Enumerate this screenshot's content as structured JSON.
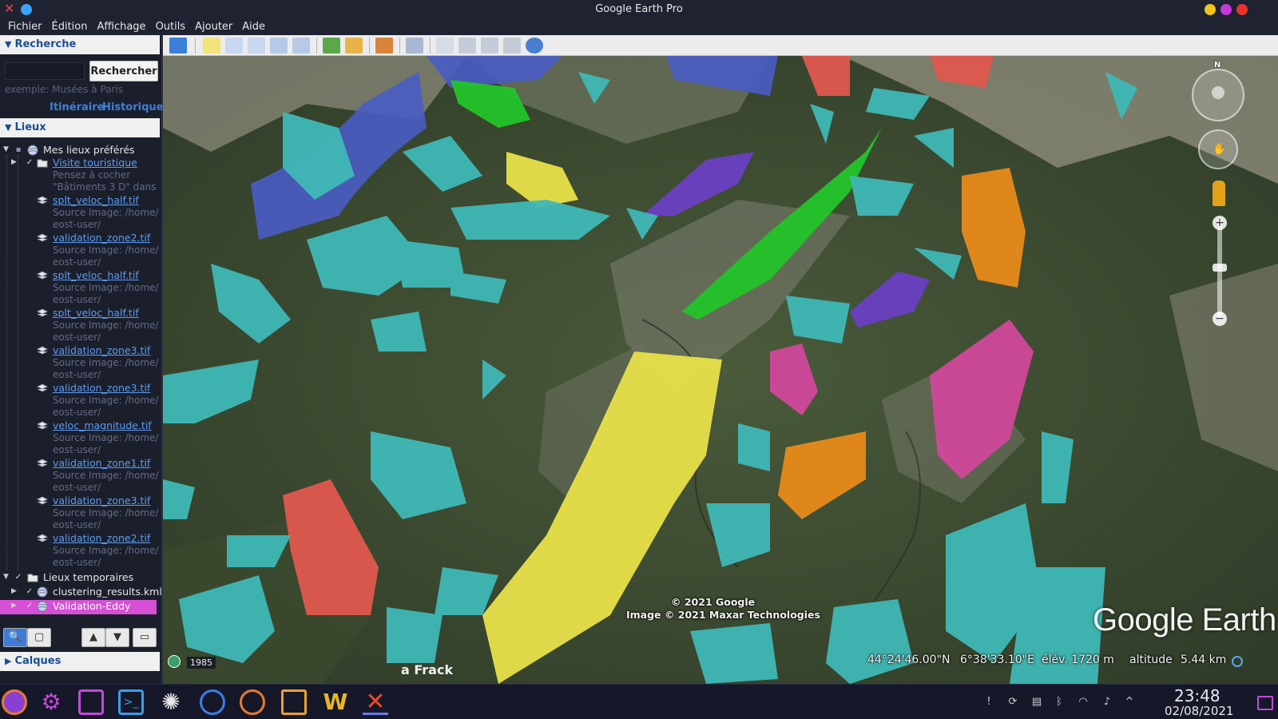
{
  "window": {
    "title": "Google Earth Pro"
  },
  "menu": [
    "Fichier",
    "Édition",
    "Affichage",
    "Outils",
    "Ajouter",
    "Aide"
  ],
  "search": {
    "header": "Recherche",
    "input_value": "",
    "button_label": "Rechercher",
    "example_hint": "exemple: Musées à Paris",
    "links": [
      "Itinéraire",
      "Historique"
    ]
  },
  "places": {
    "header": "Lieux",
    "root": "Mes lieux préférés",
    "items": [
      {
        "label": "Visite touristique",
        "sub": [
          "Pensez à cocher",
          "\"Bâtiments 3 D\" dans"
        ]
      },
      {
        "label": "splt_veloc_half.tif",
        "sub": [
          "Source Image: /home/",
          "eost-user/"
        ]
      },
      {
        "label": "validation_zone2.tif",
        "sub": [
          "Source Image: /home/",
          "eost-user/"
        ]
      },
      {
        "label": "splt_veloc_half.tif",
        "sub": [
          "Source Image: /home/",
          "eost-user/"
        ]
      },
      {
        "label": "splt_veloc_half.tif",
        "sub": [
          "Source Image: /home/",
          "eost-user/"
        ]
      },
      {
        "label": "validation_zone3.tif",
        "sub": [
          "Source Image: /home/",
          "eost-user/"
        ]
      },
      {
        "label": "validation_zone3.tif",
        "sub": [
          "Source Image: /home/",
          "eost-user/"
        ]
      },
      {
        "label": "veloc_magnitude.tif",
        "sub": [
          "Source Image: /home/",
          "eost-user/"
        ]
      },
      {
        "label": "validation_zone1.tif",
        "sub": [
          "Source Image: /home/",
          "eost-user/"
        ]
      },
      {
        "label": "validation_zone3.tif",
        "sub": [
          "Source Image: /home/",
          "eost-user/"
        ]
      },
      {
        "label": "validation_zone2.tif",
        "sub": [
          "Source Image: /home/",
          "eost-user/"
        ]
      }
    ],
    "temp_root": "Lieux temporaires",
    "temp_items": [
      "clustering_results.kml",
      "Validation-Eddy"
    ]
  },
  "layers": {
    "header": "Calques"
  },
  "map": {
    "copyright_1": "© 2021 Google",
    "copyright_2": "Image © 2021 Maxar Technologies",
    "logo": "Google Earth",
    "place_label": "a Frack",
    "year": "1985",
    "lat": "44°24'46.00\"N",
    "lon": "6°38'33.10\"E",
    "elev": "élév. 1720 m",
    "altitude_label": "altitude",
    "altitude_value": "5.44 km",
    "compass_north": "N"
  },
  "taskbar": {
    "time": "23:48",
    "date": "02/08/2021"
  },
  "colors": {
    "cyan": "#3fb8b6",
    "blue": "#4a5cc4",
    "green": "#23c42a",
    "yellow": "#e8e04a",
    "purple": "#6a3fc4",
    "red": "#e0584e",
    "orange": "#e88a1a",
    "pink": "#d0489a",
    "selected": "#d64fd6"
  }
}
